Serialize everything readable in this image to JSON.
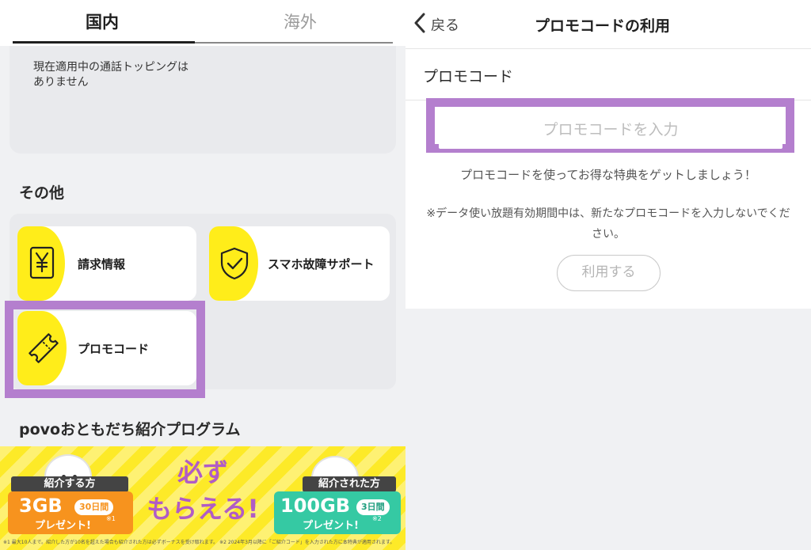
{
  "left": {
    "tabs": [
      {
        "label": "国内",
        "active": true
      },
      {
        "label": "海外",
        "active": false
      }
    ],
    "topping_status": "現在適用中の通話トッピングはありません",
    "section_other": "その他",
    "cards": {
      "billing": {
        "label": "請求情報",
        "icon": "yen-invoice-icon"
      },
      "support": {
        "label": "スマホ故障サポート",
        "icon": "shield-check-icon"
      },
      "promo": {
        "label": "プロモコード",
        "icon": "ticket-icon"
      }
    },
    "section_friends": "povoおともだち紹介プログラム",
    "banner": {
      "referrer_label": "紹介する方",
      "referrer_amount": "3GB",
      "referrer_days": "30日間",
      "referrer_present": "プレゼント!",
      "referrer_note": "※1",
      "center_line1": "必ず",
      "center_line2": "もらえる!",
      "referee_label": "紹介された方",
      "referee_amount": "100GB",
      "referee_days": "3日間",
      "referee_present": "プレゼント!",
      "referee_note": "※2",
      "disclaimer": "※1 最大10人まで。紹介した方が10名を超えた場合も紹介された方は必ずボーナスを受け取れます。 ※2 2024年3月以降に「ご紹介コード」を入力された方に本特典が適用されます。"
    }
  },
  "right": {
    "back_label": "戻る",
    "title": "プロモコードの利用",
    "promo_heading": "プロモコード",
    "input_placeholder": "プロモコードを入力",
    "input_value": "",
    "hint": "プロモコードを使ってお得な特典をゲットしましょう！",
    "note": "※データ使い放題有効期間中は、新たなプロモコードを入力しないでください。",
    "use_button": "利用する"
  },
  "colors": {
    "accent_yellow": "#ffed1a",
    "highlight_purple": "#b47fce",
    "panel_gray": "#f0f1f3"
  }
}
